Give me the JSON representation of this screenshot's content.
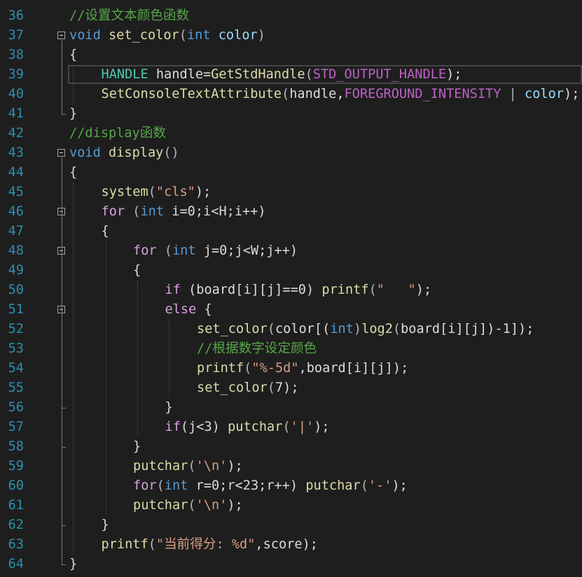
{
  "theme": {
    "background": "#1e1e1e",
    "line_number": "#2b91af",
    "keyword": "#569cd6",
    "function": "#dcdcaa",
    "string": "#d69d85",
    "comment": "#57a64a",
    "type": "#4ec9b0",
    "variable": "#9cdcfe",
    "macro": "#bd63c5"
  },
  "editor": {
    "current_line": 39,
    "fold_markers": [
      37,
      43,
      46,
      48,
      51
    ],
    "lines": [
      {
        "num": "36",
        "indent": 0,
        "tokens": [
          {
            "t": "//设置文本颜色函数",
            "c": "cmt"
          }
        ]
      },
      {
        "num": "37",
        "indent": 0,
        "tokens": [
          {
            "t": "void",
            "c": "kw"
          },
          {
            "t": " ",
            "c": "plain"
          },
          {
            "t": "set_color",
            "c": "fn"
          },
          {
            "t": "(",
            "c": "pun"
          },
          {
            "t": "int",
            "c": "kw"
          },
          {
            "t": " ",
            "c": "plain"
          },
          {
            "t": "color",
            "c": "var"
          },
          {
            "t": ")",
            "c": "pun"
          }
        ]
      },
      {
        "num": "38",
        "indent": 0,
        "tokens": [
          {
            "t": "{",
            "c": "plain"
          }
        ]
      },
      {
        "num": "39",
        "indent": 1,
        "tokens": [
          {
            "t": "HANDLE",
            "c": "type"
          },
          {
            "t": " handle=",
            "c": "plain"
          },
          {
            "t": "GetStdHandle",
            "c": "fn"
          },
          {
            "t": "(",
            "c": "pun"
          },
          {
            "t": "STD_OUTPUT_HANDLE",
            "c": "mac"
          },
          {
            "t": ");",
            "c": "plain"
          }
        ]
      },
      {
        "num": "40",
        "indent": 1,
        "tokens": [
          {
            "t": "SetConsoleTextAttribute",
            "c": "fn"
          },
          {
            "t": "(",
            "c": "pun"
          },
          {
            "t": "handle",
            "c": "plain"
          },
          {
            "t": ",",
            "c": "plain"
          },
          {
            "t": "FOREGROUND_INTENSITY",
            "c": "mac"
          },
          {
            "t": " | ",
            "c": "pun"
          },
          {
            "t": "color",
            "c": "var"
          },
          {
            "t": ");",
            "c": "plain"
          }
        ]
      },
      {
        "num": "41",
        "indent": 0,
        "tokens": [
          {
            "t": "}",
            "c": "plain"
          }
        ]
      },
      {
        "num": "42",
        "indent": 0,
        "tokens": [
          {
            "t": "//display函数",
            "c": "cmt"
          }
        ]
      },
      {
        "num": "43",
        "indent": 0,
        "tokens": [
          {
            "t": "void",
            "c": "kw"
          },
          {
            "t": " ",
            "c": "plain"
          },
          {
            "t": "display",
            "c": "fn"
          },
          {
            "t": "()",
            "c": "pun"
          }
        ]
      },
      {
        "num": "44",
        "indent": 0,
        "tokens": [
          {
            "t": "{",
            "c": "plain"
          }
        ]
      },
      {
        "num": "45",
        "indent": 1,
        "tokens": [
          {
            "t": "system",
            "c": "fn"
          },
          {
            "t": "(",
            "c": "pun"
          },
          {
            "t": "\"cls\"",
            "c": "str"
          },
          {
            "t": ");",
            "c": "plain"
          }
        ]
      },
      {
        "num": "46",
        "indent": 1,
        "tokens": [
          {
            "t": "for",
            "c": "ctl"
          },
          {
            "t": " (",
            "c": "pun"
          },
          {
            "t": "int",
            "c": "kw"
          },
          {
            "t": " i=0;i<H;i++)",
            "c": "plain"
          }
        ]
      },
      {
        "num": "47",
        "indent": 1,
        "tokens": [
          {
            "t": "{",
            "c": "plain"
          }
        ]
      },
      {
        "num": "48",
        "indent": 2,
        "tokens": [
          {
            "t": "for",
            "c": "ctl"
          },
          {
            "t": " (",
            "c": "pun"
          },
          {
            "t": "int",
            "c": "kw"
          },
          {
            "t": " j=0;j<W;j++)",
            "c": "plain"
          }
        ]
      },
      {
        "num": "49",
        "indent": 2,
        "tokens": [
          {
            "t": "{",
            "c": "plain"
          }
        ]
      },
      {
        "num": "50",
        "indent": 3,
        "tokens": [
          {
            "t": "if",
            "c": "ctl"
          },
          {
            "t": " (board[i][j]==0) ",
            "c": "plain"
          },
          {
            "t": "printf",
            "c": "fn"
          },
          {
            "t": "(",
            "c": "pun"
          },
          {
            "t": "\"   \"",
            "c": "str"
          },
          {
            "t": ");",
            "c": "plain"
          }
        ]
      },
      {
        "num": "51",
        "indent": 3,
        "tokens": [
          {
            "t": "else",
            "c": "ctl"
          },
          {
            "t": " {",
            "c": "plain"
          }
        ]
      },
      {
        "num": "52",
        "indent": 4,
        "tokens": [
          {
            "t": "set_color",
            "c": "fn"
          },
          {
            "t": "(",
            "c": "pun"
          },
          {
            "t": "color[(",
            "c": "plain"
          },
          {
            "t": "int",
            "c": "kw"
          },
          {
            "t": ")",
            "c": "pun"
          },
          {
            "t": "log2",
            "c": "fn"
          },
          {
            "t": "(",
            "c": "pun"
          },
          {
            "t": "board[i][j])-1]);",
            "c": "plain"
          }
        ]
      },
      {
        "num": "53",
        "indent": 4,
        "tokens": [
          {
            "t": "//根据数字设定颜色",
            "c": "cmt"
          }
        ]
      },
      {
        "num": "54",
        "indent": 4,
        "tokens": [
          {
            "t": "printf",
            "c": "fn"
          },
          {
            "t": "(",
            "c": "pun"
          },
          {
            "t": "\"%-5d\"",
            "c": "str"
          },
          {
            "t": ",board[i][j]);",
            "c": "plain"
          }
        ]
      },
      {
        "num": "55",
        "indent": 4,
        "tokens": [
          {
            "t": "set_color",
            "c": "fn"
          },
          {
            "t": "(",
            "c": "pun"
          },
          {
            "t": "7",
            "c": "plain"
          },
          {
            "t": ");",
            "c": "plain"
          }
        ]
      },
      {
        "num": "56",
        "indent": 3,
        "tokens": [
          {
            "t": "}",
            "c": "plain"
          }
        ]
      },
      {
        "num": "57",
        "indent": 3,
        "tokens": [
          {
            "t": "if",
            "c": "ctl"
          },
          {
            "t": "(j<3) ",
            "c": "plain"
          },
          {
            "t": "putchar",
            "c": "fn"
          },
          {
            "t": "(",
            "c": "pun"
          },
          {
            "t": "'|'",
            "c": "str"
          },
          {
            "t": ");",
            "c": "plain"
          }
        ]
      },
      {
        "num": "58",
        "indent": 2,
        "tokens": [
          {
            "t": "}",
            "c": "plain"
          }
        ]
      },
      {
        "num": "59",
        "indent": 2,
        "tokens": [
          {
            "t": "putchar",
            "c": "fn"
          },
          {
            "t": "(",
            "c": "pun"
          },
          {
            "t": "'\\n'",
            "c": "str"
          },
          {
            "t": ");",
            "c": "plain"
          }
        ]
      },
      {
        "num": "60",
        "indent": 2,
        "tokens": [
          {
            "t": "for",
            "c": "ctl"
          },
          {
            "t": "(",
            "c": "pun"
          },
          {
            "t": "int",
            "c": "kw"
          },
          {
            "t": " r=0;r<23;r++) ",
            "c": "plain"
          },
          {
            "t": "putchar",
            "c": "fn"
          },
          {
            "t": "(",
            "c": "pun"
          },
          {
            "t": "'-'",
            "c": "str"
          },
          {
            "t": ");",
            "c": "plain"
          }
        ]
      },
      {
        "num": "61",
        "indent": 2,
        "tokens": [
          {
            "t": "putchar",
            "c": "fn"
          },
          {
            "t": "(",
            "c": "pun"
          },
          {
            "t": "'\\n'",
            "c": "str"
          },
          {
            "t": ");",
            "c": "plain"
          }
        ]
      },
      {
        "num": "62",
        "indent": 1,
        "tokens": [
          {
            "t": "}",
            "c": "plain"
          }
        ]
      },
      {
        "num": "63",
        "indent": 1,
        "tokens": [
          {
            "t": "printf",
            "c": "fn"
          },
          {
            "t": "(",
            "c": "pun"
          },
          {
            "t": "\"当前得分: %d\"",
            "c": "str"
          },
          {
            "t": ",score);",
            "c": "plain"
          }
        ]
      },
      {
        "num": "64",
        "indent": 0,
        "tokens": [
          {
            "t": "}",
            "c": "plain"
          }
        ]
      }
    ]
  }
}
